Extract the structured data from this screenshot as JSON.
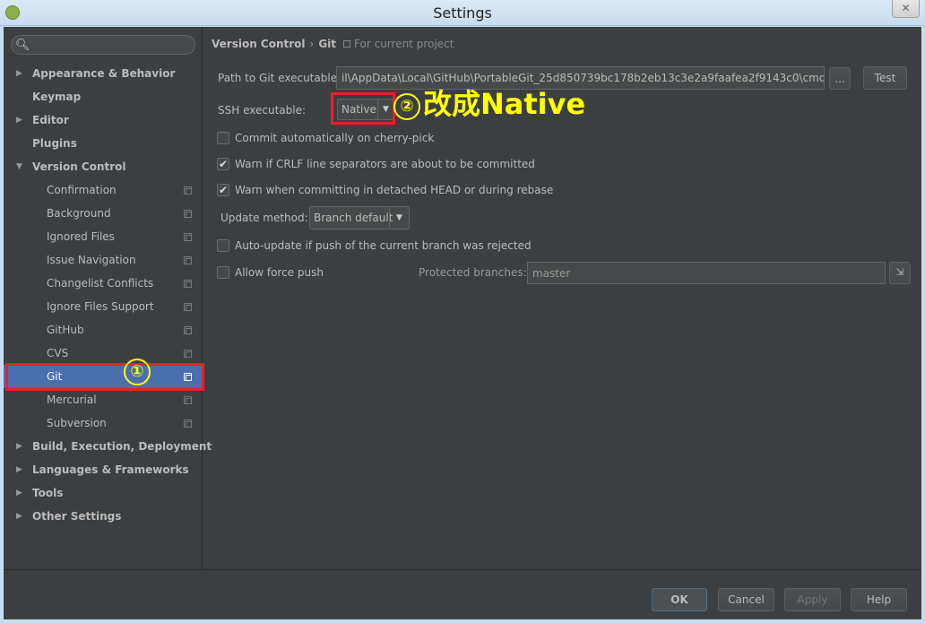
{
  "window": {
    "title": "Settings",
    "close": "✕"
  },
  "search": {
    "placeholder": "",
    "icon": "search-icon"
  },
  "sidebar": {
    "items": [
      {
        "label": "Appearance & Behavior",
        "level": "top",
        "arrow": "▶"
      },
      {
        "label": "Keymap",
        "level": "top",
        "arrow": ""
      },
      {
        "label": "Editor",
        "level": "top",
        "arrow": "▶"
      },
      {
        "label": "Plugins",
        "level": "top",
        "arrow": ""
      },
      {
        "label": "Version Control",
        "level": "top",
        "arrow": "▼"
      },
      {
        "label": "Confirmation",
        "level": "child"
      },
      {
        "label": "Background",
        "level": "child"
      },
      {
        "label": "Ignored Files",
        "level": "child"
      },
      {
        "label": "Issue Navigation",
        "level": "child"
      },
      {
        "label": "Changelist Conflicts",
        "level": "child"
      },
      {
        "label": "Ignore Files Support",
        "level": "child"
      },
      {
        "label": "GitHub",
        "level": "child"
      },
      {
        "label": "CVS",
        "level": "child"
      },
      {
        "label": "Git",
        "level": "child",
        "selected": true
      },
      {
        "label": "Mercurial",
        "level": "child"
      },
      {
        "label": "Subversion",
        "level": "child"
      },
      {
        "label": "Build, Execution, Deployment",
        "level": "top",
        "arrow": "▶"
      },
      {
        "label": "Languages & Frameworks",
        "level": "top",
        "arrow": "▶"
      },
      {
        "label": "Tools",
        "level": "top",
        "arrow": "▶"
      },
      {
        "label": "Other Settings",
        "level": "top",
        "arrow": "▶"
      }
    ]
  },
  "breadcrumb": {
    "parent": "Version Control",
    "separator": "›",
    "current": "Git",
    "note": "For current project"
  },
  "git": {
    "path_label": "Path to Git executable:",
    "path_value": "il\\AppData\\Local\\GitHub\\PortableGit_25d850739bc178b2eb13c3e2a9faafea2f9143c0\\cmd\\git.exe",
    "browse_label": "...",
    "test_label": "Test",
    "ssh_label": "SSH executable:",
    "ssh_value": "Native",
    "commit_cherry_pick": "Commit automatically on cherry-pick",
    "warn_crlf": "Warn if CRLF line separators are about to be committed",
    "warn_detached": "Warn when committing in detached HEAD or during rebase",
    "update_method_label": "Update method:",
    "update_method_value": "Branch default",
    "auto_update": "Auto-update if push of the current branch was rejected",
    "allow_force_push": "Allow force push",
    "protected_label": "Protected branches:",
    "protected_value": "master"
  },
  "checkboxes": {
    "cherry_pick": false,
    "crlf": true,
    "detached": true,
    "auto_update": false,
    "force_push": false
  },
  "annotations": {
    "one": "①",
    "two": "②",
    "text": "改成Native"
  },
  "colors": {
    "annotation": "#ffff00",
    "highlight": "#e8202a",
    "selection": "#4b6eaf"
  },
  "buttons": {
    "ok": "OK",
    "cancel": "Cancel",
    "apply": "Apply",
    "help": "Help"
  }
}
